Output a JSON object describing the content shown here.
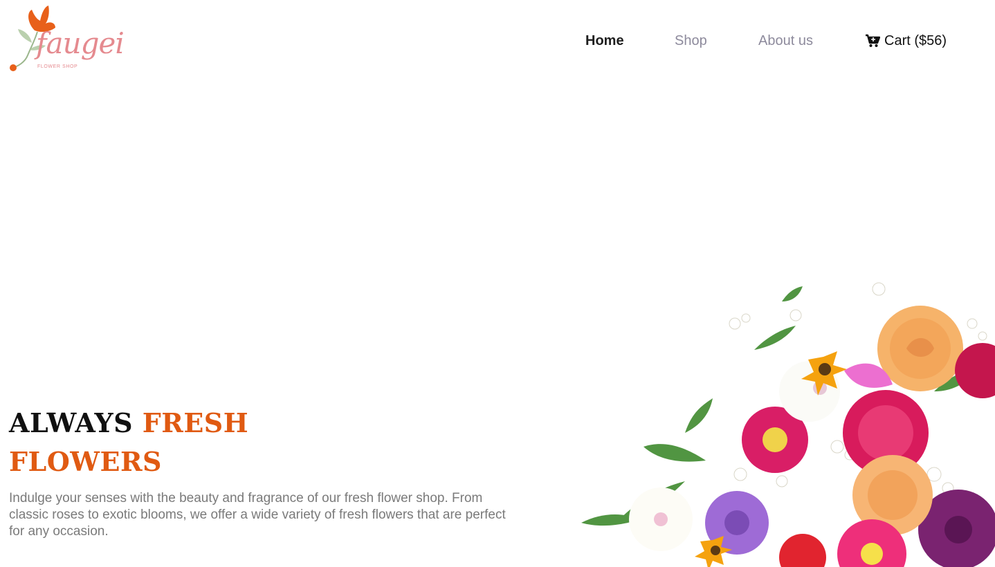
{
  "brand": {
    "name": "faugei",
    "tagline": "FLOWER SHOP"
  },
  "nav": {
    "home": "Home",
    "shop": "Shop",
    "about": "About us",
    "cart": "Cart ($56)",
    "active": "Home"
  },
  "hero": {
    "title_part1": "ALWAYS",
    "title_part2": "FRESH",
    "title_part3": "FLOWERS",
    "description": "Indulge your senses with the beauty and fragrance of our fresh flower shop. From classic roses to exotic blooms, we offer a wide variety of fresh flowers that are perfect for any occasion."
  },
  "colors": {
    "accent": "#e05a12",
    "logo_pink": "#e58a8f",
    "nav_muted": "#8d8a9c",
    "text_gray": "#7a7a7a"
  },
  "icons": {
    "cart": "shopping-cart-icon",
    "logo": "flower-logo-icon"
  }
}
